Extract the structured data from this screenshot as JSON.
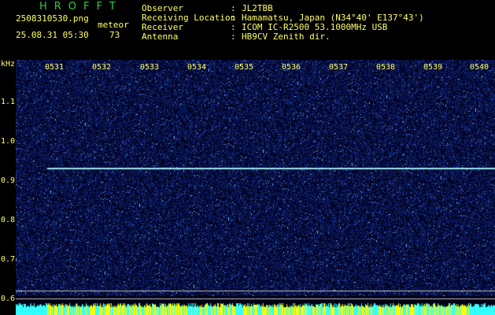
{
  "header": {
    "app_name": "HROFFT",
    "filename": "2508310530.png",
    "datetime": "25.08.31 05:30",
    "meteor_label": "meteor",
    "meteor_count": "73",
    "fields": [
      {
        "label": "Observer",
        "sep": ":",
        "value": "JL2TBB"
      },
      {
        "label": "Receiving Location",
        "sep": ":",
        "value": "Hamamatsu, Japan (N34°40' E137°43')"
      },
      {
        "label": "Receiver",
        "sep": ":",
        "value": "ICOM IC-R2500 53.1000MHz USB"
      },
      {
        "label": "Antenna",
        "sep": ":",
        "value": "HB9CV Zenith dir."
      }
    ]
  },
  "spectrogram": {
    "y_unit": "kHz",
    "y_ticks": [
      "1.1",
      "1.0",
      "0.9",
      "0.8",
      "0.7",
      "0.6"
    ],
    "x_ticks": [
      "0531",
      "0532",
      "0533",
      "0534",
      "0535",
      "0536",
      "0537",
      "0538",
      "0539",
      "0540"
    ],
    "colors": {
      "background": "#000014",
      "noise": "#2a3aa8",
      "carrier": "#88ddff",
      "bottom_band": "#ffff00",
      "bottom_band_alt": "#33ffff",
      "gridline": "#c0c0c0"
    }
  }
}
